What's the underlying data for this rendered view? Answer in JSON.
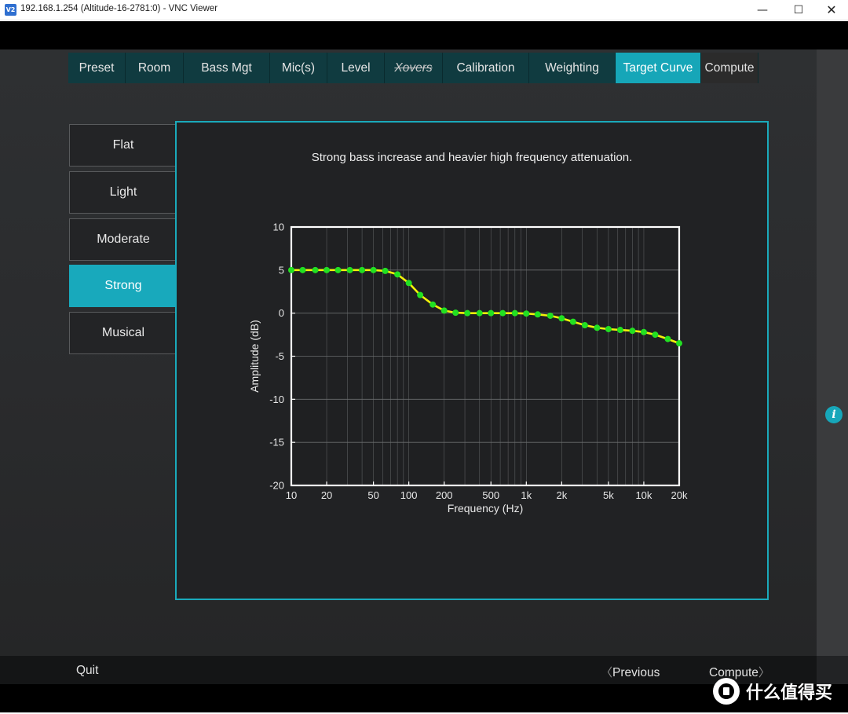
{
  "window": {
    "icon_label": "V2",
    "title": "192.168.1.254 (Altitude-16-2781:0) - VNC Viewer",
    "minimize": "—",
    "maximize": "☐",
    "close": "✕"
  },
  "tabs": [
    {
      "label": "Preset",
      "state": "normal"
    },
    {
      "label": "Room",
      "state": "normal"
    },
    {
      "label": "Bass Mgt",
      "state": "normal"
    },
    {
      "label": "Mic(s)",
      "state": "normal"
    },
    {
      "label": "Level",
      "state": "normal"
    },
    {
      "label": "Xovers",
      "state": "disabled"
    },
    {
      "label": "Calibration",
      "state": "normal"
    },
    {
      "label": "Weighting",
      "state": "normal"
    },
    {
      "label": "Target Curve",
      "state": "active"
    },
    {
      "label": "Compute",
      "state": "normal"
    }
  ],
  "presets": [
    {
      "label": "Flat",
      "selected": false
    },
    {
      "label": "Light",
      "selected": false
    },
    {
      "label": "Moderate",
      "selected": false
    },
    {
      "label": "Strong",
      "selected": true
    },
    {
      "label": "Musical",
      "selected": false
    }
  ],
  "panel": {
    "description": "Strong bass increase and heavier high frequency attenuation."
  },
  "chart_data": {
    "type": "line",
    "xlabel": "Frequency (Hz)",
    "ylabel": "Amplitude (dB)",
    "x_scale": "log",
    "xlim": [
      10,
      20000
    ],
    "ylim": [
      -20,
      10
    ],
    "grid": true,
    "x_ticks": [
      {
        "v": 10,
        "label": "10"
      },
      {
        "v": 20,
        "label": "20"
      },
      {
        "v": 50,
        "label": "50"
      },
      {
        "v": 100,
        "label": "100"
      },
      {
        "v": 200,
        "label": "200"
      },
      {
        "v": 500,
        "label": "500"
      },
      {
        "v": 1000,
        "label": "1k"
      },
      {
        "v": 2000,
        "label": "2k"
      },
      {
        "v": 5000,
        "label": "5k"
      },
      {
        "v": 10000,
        "label": "10k"
      },
      {
        "v": 20000,
        "label": "20k"
      }
    ],
    "y_ticks": [
      10,
      5,
      0,
      -5,
      -10,
      -15,
      -20
    ],
    "line_color": "#f2f20a",
    "marker_color": "#22e022",
    "points": [
      [
        10,
        5.0
      ],
      [
        12.5,
        5.0
      ],
      [
        16,
        5.0
      ],
      [
        20,
        5.0
      ],
      [
        25,
        5.0
      ],
      [
        31.5,
        5.0
      ],
      [
        40,
        5.0
      ],
      [
        50,
        5.0
      ],
      [
        63,
        4.9
      ],
      [
        80,
        4.5
      ],
      [
        100,
        3.5
      ],
      [
        125,
        2.1
      ],
      [
        160,
        1.0
      ],
      [
        200,
        0.3
      ],
      [
        250,
        0.05
      ],
      [
        315,
        0.0
      ],
      [
        400,
        0.0
      ],
      [
        500,
        0.0
      ],
      [
        630,
        0.0
      ],
      [
        800,
        0.0
      ],
      [
        1000,
        -0.05
      ],
      [
        1250,
        -0.15
      ],
      [
        1600,
        -0.3
      ],
      [
        2000,
        -0.6
      ],
      [
        2500,
        -1.0
      ],
      [
        3150,
        -1.4
      ],
      [
        4000,
        -1.7
      ],
      [
        5000,
        -1.85
      ],
      [
        6300,
        -1.95
      ],
      [
        8000,
        -2.05
      ],
      [
        10000,
        -2.2
      ],
      [
        12500,
        -2.5
      ],
      [
        16000,
        -3.0
      ],
      [
        20000,
        -3.5
      ]
    ]
  },
  "bottom": {
    "quit": "Quit",
    "previous_chevron": "〈",
    "previous": "Previous",
    "compute": "Compute",
    "compute_chevron": "〉"
  },
  "info_button": {
    "icon": "info-icon",
    "glyph": "i"
  },
  "watermark": {
    "text": "什么值得买"
  }
}
